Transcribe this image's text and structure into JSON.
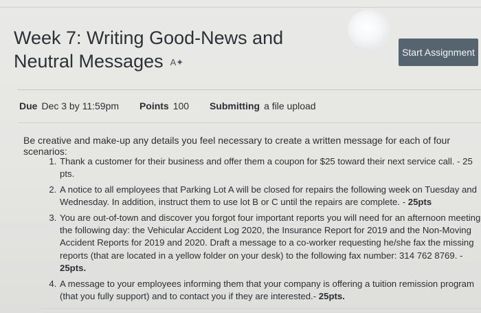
{
  "assignment": {
    "title": "Week 7: Writing Good-News and Neutral Messages",
    "published_icon": "published-icon",
    "start_button": "Start Assignment"
  },
  "details": {
    "due_label": "Due",
    "due_value": "Dec 3 by 11:59pm",
    "points_label": "Points",
    "points_value": "100",
    "submitting_label": "Submitting",
    "submitting_value": "a file upload"
  },
  "description": {
    "intro": "Be creative and make-up any details you feel necessary to create a written message for each of four scenarios:",
    "items": [
      {
        "text": "Thank a customer for their business and offer them a coupon for $25 toward their next service call. - 25 pts."
      },
      {
        "text": "A notice to all employees that Parking Lot A will be closed for repairs the following week on Tuesday and Wednesday. In addition, instruct them to use lot B or C until the repairs are complete. - ",
        "points": "25pts"
      },
      {
        "text": "You are out-of-town and discover you forgot four important reports you will need for an afternoon meeting the following day: the Vehicular Accident Log 2020, the Insurance Report for 2019 and the Non-Moving Accident Reports for 2019 and 2020. Draft a message to a co-worker requesting he/she fax the missing reports (that are located in a yellow folder on your desk) to the following fax number: 314 762 8769. - ",
        "points": "25pts."
      },
      {
        "text": "A message to your employees informing them that your company is offering a tuition remission program (that you fully support) and to contact you if they are interested.- ",
        "points": "25pts."
      }
    ]
  },
  "colors": {
    "button_bg": "#566470",
    "text": "#2b2f33"
  }
}
